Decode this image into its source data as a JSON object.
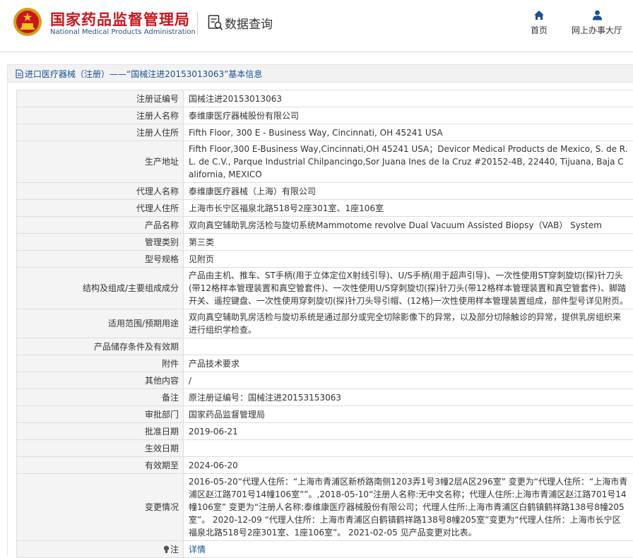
{
  "header": {
    "org_name_cn": "国家药品监督管理局",
    "org_name_en": "National Medical Products Administration",
    "page_title": "数据查询",
    "nav": [
      {
        "label": "首页",
        "icon": "home-icon"
      },
      {
        "label": "网上办事大厅",
        "icon": "user-icon"
      }
    ]
  },
  "breadcrumb": {
    "text": "进口医疗器械（注册）——“国械注进20153013063”基本信息"
  },
  "table": {
    "rows": [
      {
        "label": "注册证编号",
        "value": "国械注进20153013063"
      },
      {
        "label": "注册人名称",
        "value": "泰维康医疗器械股份有限公司"
      },
      {
        "label": "注册人住所",
        "value": "Fifth Floor, 300 E - Business Way, Cincinnati, OH 45241 USA"
      },
      {
        "label": "生产地址",
        "value": "Fifth Floor,300 E-Business Way,Cincinnati,OH 45241 USA；Devicor Medical Products de Mexico, S. de R.L. de C.V., Parque Industrial Chilpancingo,Sor Juana Ines de la Cruz #20152-4B, 22440, Tijuana, Baja California, MEXICO"
      },
      {
        "label": "代理人名称",
        "value": "泰维康医疗器械（上海）有限公司"
      },
      {
        "label": "代理人住所",
        "value": "上海市长宁区福泉北路518号2座301室、1座106室"
      },
      {
        "label": "产品名称",
        "value": "双向真空辅助乳房活检与旋切系统Mammotome revolve Dual Vacuum Assisted Biopsy（VAB） System"
      },
      {
        "label": "管理类别",
        "value": "第三类"
      },
      {
        "label": "型号规格",
        "value": "见附页"
      },
      {
        "label": "结构及组成/主要组成成分",
        "value": "产品由主机、推车、ST手柄(用于立体定位X射线引导)、U/S手柄(用于超声引导)、一次性使用ST穿刺旋切(探)针刀头(带12格样本管理装置和真空管套件)、一次性使用U/S穿刺旋切(探)针刀头(带12格样本管理装置和真空管套件)、脚踏开关、遥控键盘、一次性使用穿刺旋切(探)针刀头导引帽、(12格)一次性使用样本管理装置组成，部件型号详见附页。"
      },
      {
        "label": "适用范围/预期用途",
        "value": "双向真空辅助乳房活检与旋切系统是通过部分或完全切除影像下的异常，以及部分切除触诊的异常，提供乳房组织来进行组织学检查。"
      },
      {
        "label": "产品储存条件及有效期",
        "value": ""
      },
      {
        "label": "附件",
        "value": "产品技术要求"
      },
      {
        "label": "其他内容",
        "value": "/"
      },
      {
        "label": "备注",
        "value": "原注册证编号：国械注进20153153063"
      },
      {
        "label": "审批部门",
        "value": "国家药品监督管理局"
      },
      {
        "label": "批准日期",
        "value": "2019-06-21"
      },
      {
        "label": "生效日期",
        "value": ""
      },
      {
        "label": "有效期至",
        "value": "2024-06-20"
      },
      {
        "label": "变更情况",
        "value": "2016-05-20“代理人住所：“上海市青浦区新桥路南侧1203弄1号3幢2层A区296室” 变更为“代理人住所：“上海市青浦区赵江路701号14幢106室””。,2018-05-10“注册人名称:无中文名称；代理人住所:上海市青浦区赵江路701号14幢106室” 变更为“注册人名称:泰维康医疗器械股份有限公司；代理人住所:上海市青浦区白鹤镇鹤祥路138号8幢205室”。 2020-12-09 “代理人住所：上海市青浦区白鹤镇鹤祥路138号8幢205室”变更为“代理人住所：上海市长宁区福泉北路518号2座301室、1座106室”。 2021-02-05 见产品变更对比表。"
      }
    ],
    "note_label": "注",
    "note_link": "详情"
  },
  "colors": {
    "brand_red": "#c8161e",
    "link_blue": "#1b4f93",
    "label_bg": "#f4f4f4",
    "border": "#dddddd"
  }
}
